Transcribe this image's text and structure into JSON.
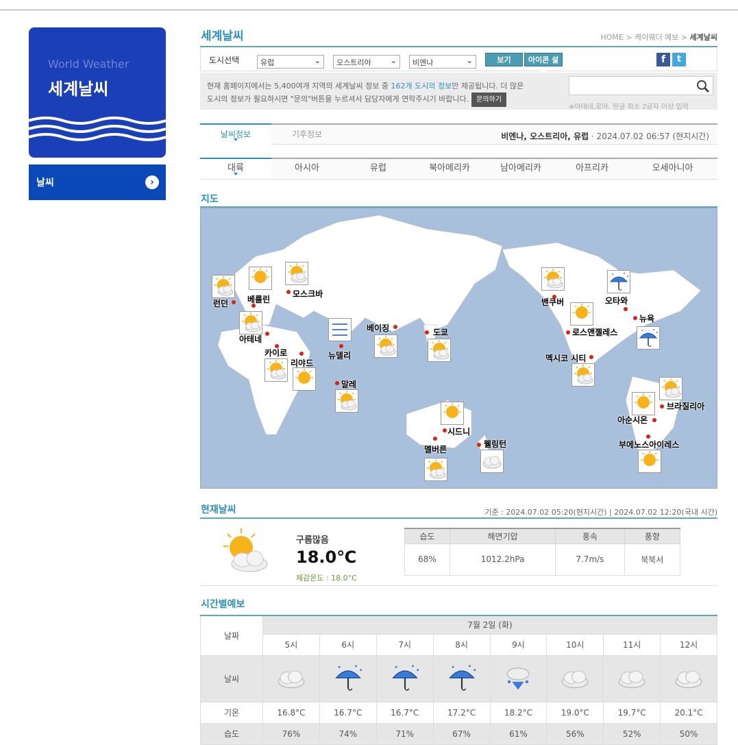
{
  "sidebar": {
    "banner_en": "World Weather",
    "banner_ko": "세계날씨",
    "menu_label": "날씨",
    "menu_arrow": "›"
  },
  "header": {
    "title": "세계날씨",
    "breadcrumb": {
      "home": "HOME",
      "sep1": " > ",
      "mid": "케이웨더 예보",
      "sep2": " > ",
      "current": "세계날씨"
    }
  },
  "selector": {
    "label": "도시선택",
    "continent": "유럽",
    "country": "오스트리아",
    "city": "비엔나",
    "view_button": "보기",
    "icon_desc_button": "아이콘 설명",
    "facebook": "f",
    "twitter": "t"
  },
  "info": {
    "text1": "현재 홈페이지에서는 5,400여개 지역의 세계날씨 정보 중 ",
    "highlight": "162개 도시의 정보",
    "text2": "만 제공됩니다. 더 많은",
    "text3": "도시의 정보가 필요하시면 \"문의\"버튼을 누르셔서 담당자에게 연락주시기 바랍니다.",
    "ask_button": "문의하기",
    "search_placeholder": "",
    "search_note": "※아테네,로마, 한글 최소 2글자 이상 입력"
  },
  "info_tabs": {
    "tabs": [
      "날씨정보",
      "기후정보"
    ],
    "location": "비엔나, 오스트리아, 유럽",
    "time": " · 2024.07.02 06:57 (현지시간)"
  },
  "region_tabs": [
    "대륙",
    "아시아",
    "유럽",
    "북아메리카",
    "남아메리카",
    "아프리카",
    "오세아니아"
  ],
  "map": {
    "title": "지도",
    "cities": [
      "런던",
      "베를린",
      "모스크바",
      "아테네",
      "카이로",
      "리야드",
      "뉴델리",
      "베이징",
      "도쿄",
      "말레",
      "시드니",
      "멜버른",
      "웰링턴",
      "밴쿠버",
      "오타와",
      "뉴욕",
      "로스앤젤레스",
      "멕시코 시티",
      "아순시온",
      "브라질리아",
      "부에노스아이레스"
    ]
  },
  "current": {
    "title": "현재날씨",
    "standard": "기준 : 2024.07.02 05:20(현지시간) | 2024.07.02 12:20(국내 시간)",
    "desc": "구름많음",
    "temp": "18.0℃",
    "feels": "체감온도 : 18.0°C",
    "headers": [
      "습도",
      "해면기압",
      "풍속",
      "풍향"
    ],
    "values": [
      "68%",
      "1012.2hPa",
      "7.7m/s",
      "북북서"
    ]
  },
  "hourly": {
    "title": "시간별예보",
    "row_labels": [
      "날짜",
      "날씨",
      "기온",
      "습도"
    ],
    "date": "7월 2일 (화)",
    "hours": [
      "5시",
      "6시",
      "7시",
      "8시",
      "9시",
      "10시",
      "11시",
      "12시"
    ],
    "weather": [
      "cloud-icon",
      "rain-umbrella-icon",
      "rain-umbrella-icon",
      "rain-umbrella-icon",
      "drizzle-icon",
      "cloud-icon",
      "cloud-icon",
      "cloud-icon"
    ],
    "temps": [
      "16.8°C",
      "16.7°C",
      "16.7°C",
      "17.2°C",
      "18.2°C",
      "19.0°C",
      "19.7°C",
      "20.1°C"
    ],
    "humidity": [
      "76%",
      "74%",
      "71%",
      "67%",
      "61%",
      "56%",
      "52%",
      "50%"
    ]
  }
}
